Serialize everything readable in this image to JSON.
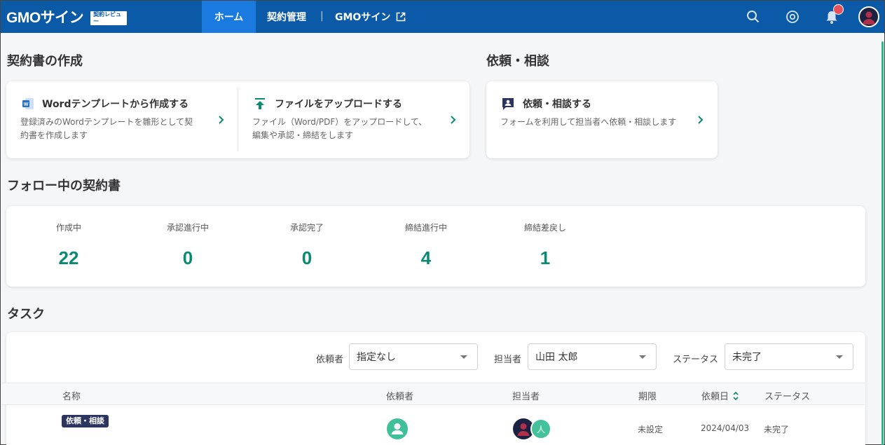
{
  "header": {
    "logo": "GMOサイン",
    "badge": "契約レビュー",
    "nav": {
      "home": "ホーム",
      "contracts": "契約管理",
      "separator": "|",
      "gmosign": "GMOサイン"
    },
    "icons": [
      "search-icon",
      "mention-icon",
      "bell-icon",
      "user-avatar"
    ],
    "accent": "#0b5aa8",
    "active_tab_color": "#1a7ae0"
  },
  "create": {
    "title": "契約書の作成",
    "word": {
      "title": "Wordテンプレートから作成する",
      "desc1": "登録済みのWordテンプレートを雛形として契",
      "desc2": "約書を作成します"
    },
    "upload": {
      "title": "ファイルをアップロードする",
      "desc1": "ファイル（Word/PDF）をアップロードして、",
      "desc2": "編集や承認・締結をします"
    }
  },
  "request": {
    "title": "依頼・相談",
    "card": {
      "title": "依頼・相談する",
      "desc": "フォームを利用して担当者へ依頼・相談します"
    }
  },
  "follow": {
    "title": "フォロー中の契約書",
    "stats": [
      {
        "label": "作成中",
        "value": "22"
      },
      {
        "label": "承認進行中",
        "value": "0"
      },
      {
        "label": "承認完了",
        "value": "0"
      },
      {
        "label": "締結進行中",
        "value": "4"
      },
      {
        "label": "締結差戻し",
        "value": "1"
      }
    ],
    "value_color": "#0a8a74"
  },
  "tasks": {
    "title": "タスク",
    "filters": {
      "requester_label": "依頼者",
      "requester_value": "指定なし",
      "assignee_label": "担当者",
      "assignee_value": "山田 太郎",
      "status_label": "ステータス",
      "status_value": "未完了"
    },
    "columns": {
      "name": "名称",
      "requester": "依頼者",
      "assignee": "担当者",
      "deadline": "期限",
      "requested": "依頼日",
      "status": "ステータス"
    },
    "rows": [
      {
        "tag": "依頼・相談",
        "assignee_initial": "人",
        "deadline": "未設定",
        "requested": "2024/04/03",
        "status": "未完了"
      }
    ]
  }
}
